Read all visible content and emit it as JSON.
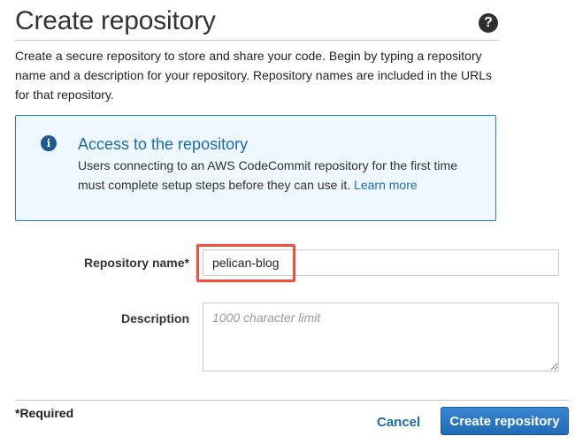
{
  "header": {
    "title": "Create repository",
    "help_icon": "question-circle-icon"
  },
  "intro": {
    "text": "Create a secure repository to store and share your code. Begin by typing a repository name and a description for your repository. Repository names are included in the URLs for that repository."
  },
  "info_box": {
    "icon": "info-circle-icon",
    "icon_glyph": "i",
    "title": "Access to the repository",
    "text": "Users connecting to an AWS CodeCommit repository for the first time must complete setup steps before they can use it. ",
    "link_label": "Learn more"
  },
  "form": {
    "name_label": "Repository name*",
    "name_value": "pelican-blog",
    "description_label": "Description",
    "description_placeholder": "1000 character limit",
    "description_value": ""
  },
  "footer": {
    "required_note": "*Required",
    "cancel_label": "Cancel",
    "create_label": "Create repository"
  },
  "colors": {
    "accent": "#1c6aa8",
    "highlight": "#e8533f",
    "info_bg": "#eef7fd",
    "primary_button": "#2674c4"
  }
}
